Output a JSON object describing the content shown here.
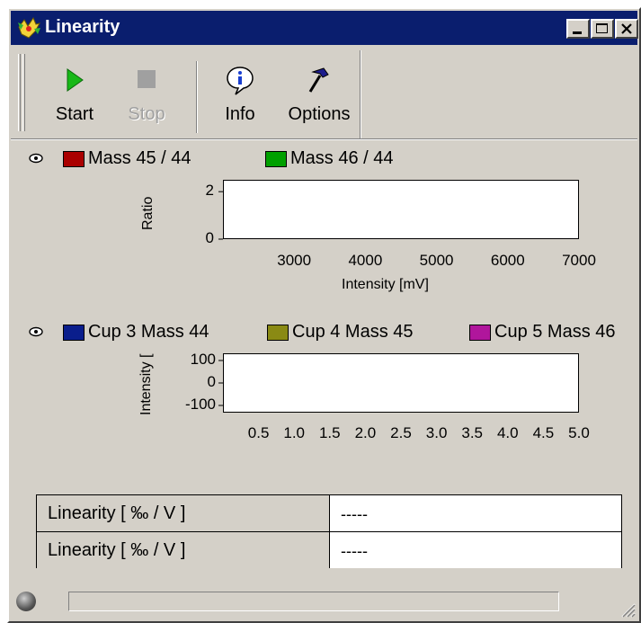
{
  "window": {
    "title": "Linearity",
    "title_bar_color": "#0a1e6e",
    "controls": [
      "minimize-icon",
      "maximize-icon",
      "close-icon"
    ]
  },
  "toolbar": {
    "buttons": [
      {
        "label": "Start",
        "icon": "play-icon",
        "enabled": true,
        "icon_color": "#18b818"
      },
      {
        "label": "Stop",
        "icon": "stop-icon",
        "enabled": false
      },
      {
        "label": "Info",
        "icon": "info-icon",
        "enabled": true
      },
      {
        "label": "Options",
        "icon": "hammer-icon",
        "enabled": true
      }
    ]
  },
  "plot1": {
    "legend": [
      {
        "label": "Mass 45 / 44",
        "color": "#aa0000"
      },
      {
        "label": "Mass 46 / 44",
        "color": "#00a000"
      }
    ],
    "chart_data": {
      "type": "scatter",
      "ylabel": "Ratio",
      "xlabel": "Intensity [mV]",
      "xlim": [
        2000,
        7000
      ],
      "ylim": [
        0,
        2.5
      ],
      "x_ticks": [
        "3000",
        "4000",
        "5000",
        "6000",
        "7000"
      ],
      "y_ticks": [
        "2",
        "0"
      ],
      "series": [
        {
          "name": "Mass 45 / 44",
          "values": []
        },
        {
          "name": "Mass 46 / 44",
          "values": []
        }
      ]
    }
  },
  "plot2": {
    "legend": [
      {
        "label": "Cup 3 Mass 44",
        "color": "#0a1e8c"
      },
      {
        "label": "Cup 4 Mass 45",
        "color": "#8a8a14"
      },
      {
        "label": "Cup 5 Mass 46",
        "color": "#b0169c"
      }
    ],
    "chart_data": {
      "type": "line",
      "ylabel": "Intensity [",
      "xlabel": "",
      "xlim": [
        0,
        5.0
      ],
      "ylim": [
        -100,
        100
      ],
      "x_ticks": [
        "0.5",
        "1.0",
        "1.5",
        "2.0",
        "2.5",
        "3.0",
        "3.5",
        "4.0",
        "4.5",
        "5.0"
      ],
      "y_ticks": [
        "100",
        "0",
        "-100"
      ],
      "series": [
        {
          "name": "Cup 3 Mass 44",
          "values": []
        },
        {
          "name": "Cup 4 Mass 45",
          "values": []
        },
        {
          "name": "Cup 5 Mass 46",
          "values": []
        }
      ]
    }
  },
  "results": [
    {
      "label": "Linearity [ ‰ / V ]",
      "value": "-----"
    },
    {
      "label": "Linearity [ ‰ / V ]",
      "value": "-----"
    }
  ],
  "status": {
    "progress": 0
  }
}
